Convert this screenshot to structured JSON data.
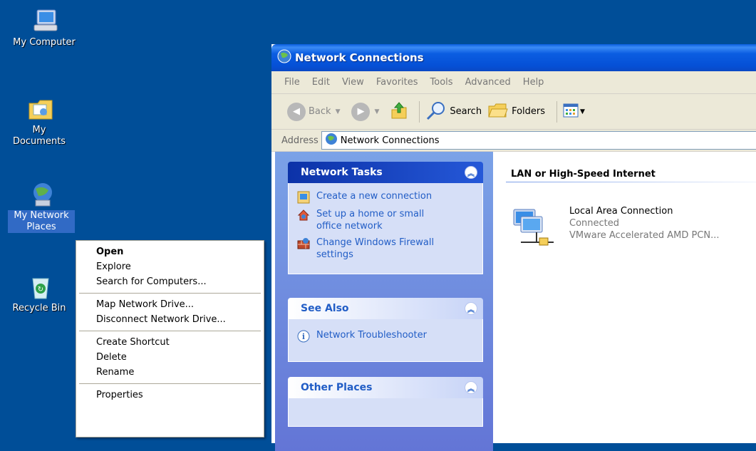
{
  "desktop": {
    "icons": [
      {
        "label": "My Computer"
      },
      {
        "label": "My Documents"
      },
      {
        "label": "My Network Places"
      },
      {
        "label": "Recycle Bin"
      }
    ]
  },
  "window": {
    "title": "Network Connections",
    "menu": [
      "File",
      "Edit",
      "View",
      "Favorites",
      "Tools",
      "Advanced",
      "Help"
    ],
    "toolbar": {
      "back": "Back",
      "search": "Search",
      "folders": "Folders"
    },
    "address": {
      "label": "Address",
      "value": "Network Connections"
    },
    "network_tasks": {
      "title": "Network Tasks",
      "items": [
        {
          "label": "Create a new connection"
        },
        {
          "label": "Set up a home or small office network"
        },
        {
          "label": "Change Windows Firewall settings"
        }
      ]
    },
    "see_also": {
      "title": "See Also",
      "items": [
        {
          "label": "Network Troubleshooter"
        }
      ]
    },
    "other_places": {
      "title": "Other Places"
    },
    "content": {
      "group_header": "LAN or High-Speed Internet",
      "connection": {
        "name": "Local Area Connection",
        "status": "Connected",
        "device": "VMware Accelerated AMD PCN..."
      }
    }
  },
  "context_menu": {
    "items": [
      {
        "label": "Open",
        "default": true
      },
      {
        "label": "Explore"
      },
      {
        "label": "Search for Computers..."
      },
      {
        "separator": true
      },
      {
        "label": "Map Network Drive..."
      },
      {
        "label": "Disconnect Network Drive..."
      },
      {
        "separator": true
      },
      {
        "label": "Create Shortcut"
      },
      {
        "label": "Delete"
      },
      {
        "label": "Rename"
      },
      {
        "separator": true
      },
      {
        "label": "Properties"
      }
    ]
  },
  "colors": {
    "desktop": "#004e98",
    "selection": "#316ac5",
    "link": "#215dc6"
  }
}
